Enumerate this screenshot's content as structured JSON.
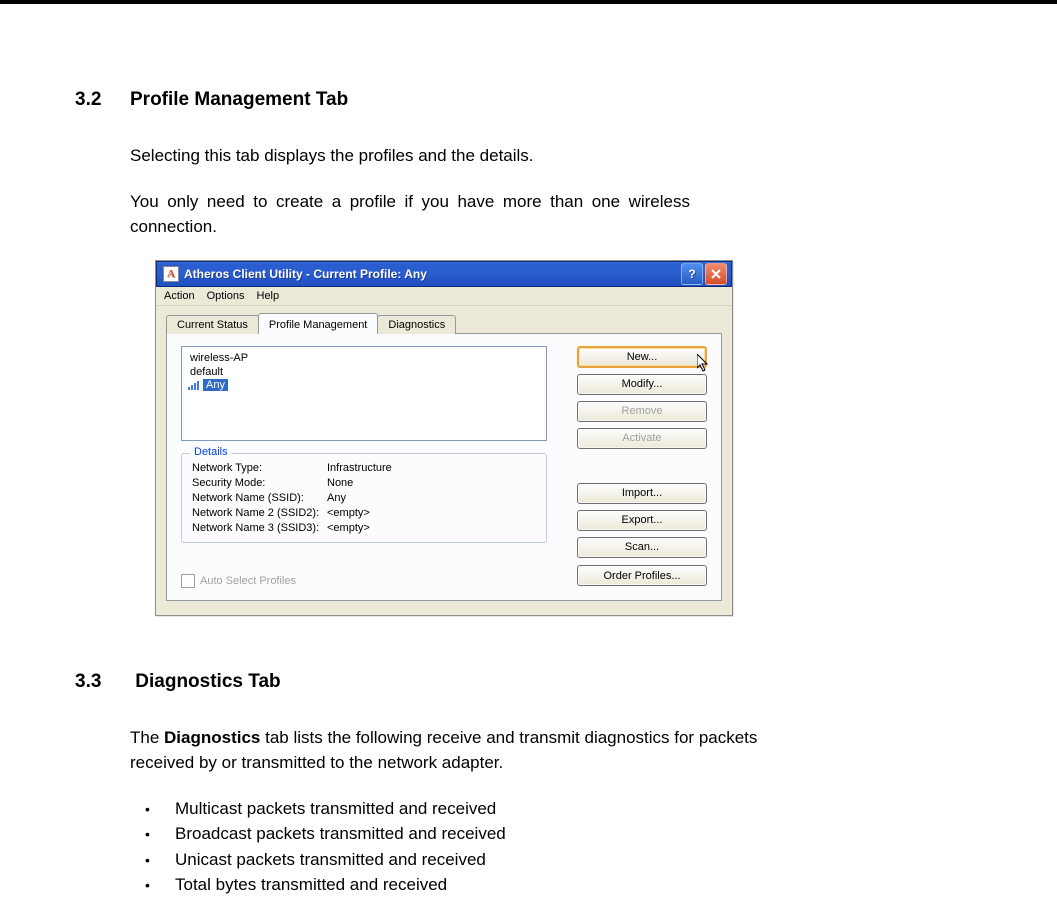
{
  "section32": {
    "number": "3.2",
    "title": "Profile Management Tab",
    "p1": "Selecting this tab displays the profiles and the details.",
    "p2": "You only need to create a profile if you have more than one wireless connection."
  },
  "dialog": {
    "title": "Atheros Client Utility - Current Profile: Any",
    "menu": {
      "action": "Action",
      "options": "Options",
      "help": "Help"
    },
    "tabs": {
      "status": "Current Status",
      "profile": "Profile Management",
      "diag": "Diagnostics"
    },
    "profiles": {
      "p0": "wireless-AP",
      "p1": "default",
      "p2": "Any"
    },
    "details_legend": "Details",
    "details": {
      "l0": "Network Type:",
      "v0": "Infrastructure",
      "l1": "Security Mode:",
      "v1": "None",
      "l2": "Network Name (SSID):",
      "v2": "Any",
      "l3": "Network Name 2 (SSID2):",
      "v3": "<empty>",
      "l4": "Network Name 3 (SSID3):",
      "v4": "<empty>"
    },
    "buttons": {
      "new": "New...",
      "modify": "Modify...",
      "remove": "Remove",
      "activate": "Activate",
      "import": "Import...",
      "export": "Export...",
      "scan": "Scan...",
      "order": "Order Profiles..."
    },
    "autoselect": "Auto Select Profiles"
  },
  "section33": {
    "number": "3.3",
    "title": "Diagnostics Tab",
    "p1a": "The ",
    "p1b": "Diagnostics",
    "p1c": " tab lists the following receive and transmit diagnostics for packets received by or transmitted to the network adapter.",
    "bullets": {
      "b0": "Multicast packets transmitted and received",
      "b1": "Broadcast packets transmitted and received",
      "b2": "Unicast packets transmitted and received",
      "b3": "Total bytes transmitted and received"
    }
  }
}
